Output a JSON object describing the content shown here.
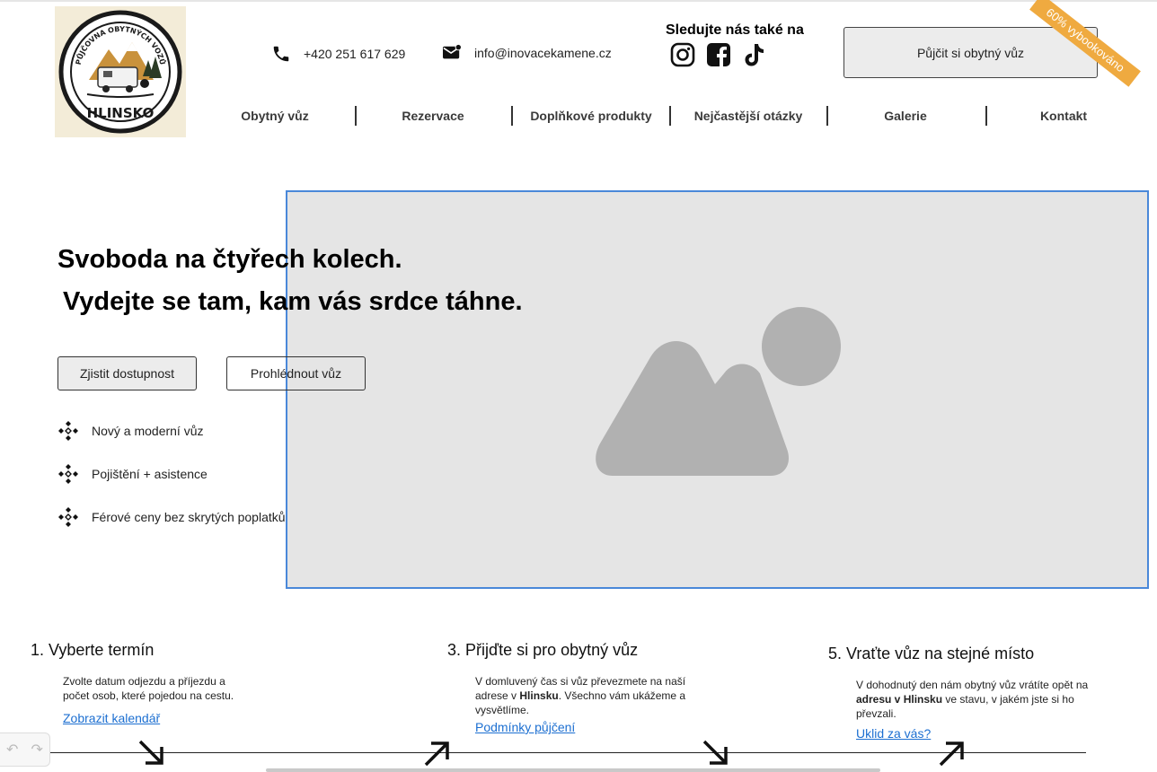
{
  "logo": {
    "arc_text": "PŮJČOVNA OBYTNÝCH VOZŮ",
    "bottom_text": "HLINSKO"
  },
  "contact": {
    "phone": "+420 251 617 629",
    "email": "info@inovacekamene.cz"
  },
  "social": {
    "heading": "Sledujte nás také na",
    "icons": [
      "instagram-icon",
      "facebook-icon",
      "tiktok-icon"
    ]
  },
  "cta": {
    "label": "Půjčit si obytný vůz",
    "ribbon": "60% vybookováno"
  },
  "nav": [
    "Obytný vůz",
    "Rezervace",
    "Doplňkové produkty",
    "Nejčastější otázky",
    "Galerie",
    "Kontakt"
  ],
  "hero": {
    "title_line1": "Svoboda na čtyřech kolech.",
    "title_line2": "Vydejte se tam, kam vás srdce táhne.",
    "button_primary": "Zjistit dostupnost",
    "button_secondary": "Prohlédnout vůz",
    "features": [
      "Nový a moderní vůz",
      "Pojištění + asistence",
      "Férové ceny bez skrytých poplatků"
    ]
  },
  "steps": [
    {
      "title": "1. Vyberte termín",
      "text": "Zvolte datum odjezdu a příjezdu a počet osob, které pojedou na cestu.",
      "link": "Zobrazit kalendář"
    },
    {
      "title": "3. Přijďte si pro obytný vůz",
      "text_before": "V domluvený čas si vůz převezmete na naší adrese v ",
      "text_bold": "Hlinsku",
      "text_after": ". Všechno vám ukážeme a vysvětlíme.",
      "link": "Podmínky půjčení"
    },
    {
      "title": "5. Vraťte vůz na stejné místo",
      "text_before": "V dohodnutý den nám obytný vůz vrátíte opět na ",
      "text_bold": "adresu v Hlinsku",
      "text_after": " ve stavu, v jakém jste si ho převzali.",
      "link": "Uklid za vás?"
    }
  ],
  "colors": {
    "accent_ribbon": "#efaa40",
    "link": "#1c6fd1",
    "image_border": "#4a88d9",
    "placeholder": "#e5e5e5"
  }
}
